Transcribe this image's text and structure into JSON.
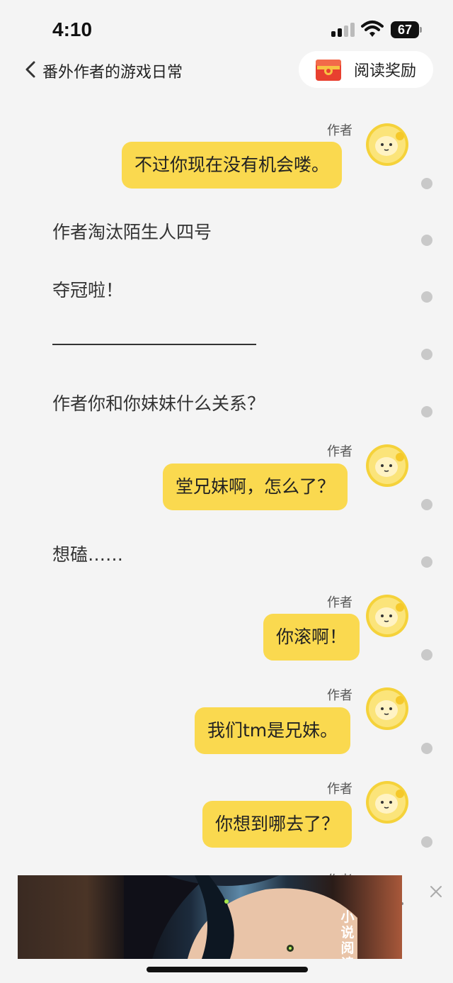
{
  "status_bar": {
    "time": "4:10",
    "battery": "67"
  },
  "header": {
    "back_icon": "chevron-left-icon",
    "book_title": "番外作者的游戏日常",
    "reward_label": "阅读奖励",
    "reward_icon": "gift-icon"
  },
  "colors": {
    "bubble": "#fad94f",
    "background": "#f4f4f4",
    "dot": "#c9c9c9"
  },
  "messages": [
    {
      "speaker": "作者",
      "text": "不过你现在没有机会喽。"
    },
    {
      "narration": "作者淘汰陌生人四号"
    },
    {
      "narration": "夺冠啦！"
    },
    {
      "divider": "————————————"
    },
    {
      "narration": "作者你和你妹妹什么关系？"
    },
    {
      "speaker": "作者",
      "text": "堂兄妹啊，怎么了？"
    },
    {
      "narration": "想磕……"
    },
    {
      "speaker": "作者",
      "text": "你滚啊！"
    },
    {
      "speaker": "作者",
      "text": "我们tm是兄妹。"
    },
    {
      "speaker": "作者",
      "text": "你想到哪去了？"
    }
  ],
  "ad": {
    "text": "小说阅读",
    "close_icon": "close-icon"
  }
}
